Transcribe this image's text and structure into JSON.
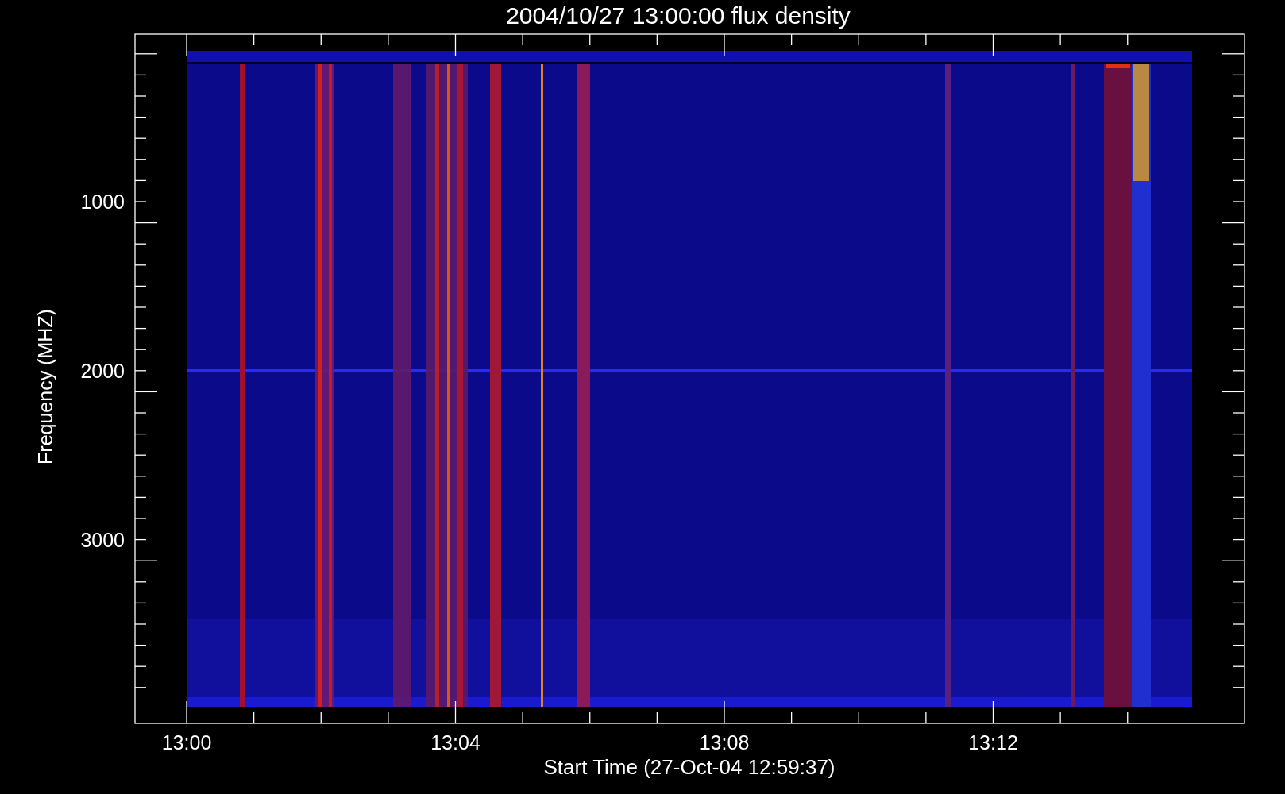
{
  "title": "2004/10/27 13:00:00 flux density",
  "ylabel": "Frequency (MHZ)",
  "xlabel": "Start Time (27-Oct-04 12:59:37)",
  "yticks": [
    "1000",
    "2000",
    "3000"
  ],
  "xticks": [
    "13:00",
    "13:04",
    "13:08",
    "13:12"
  ]
}
